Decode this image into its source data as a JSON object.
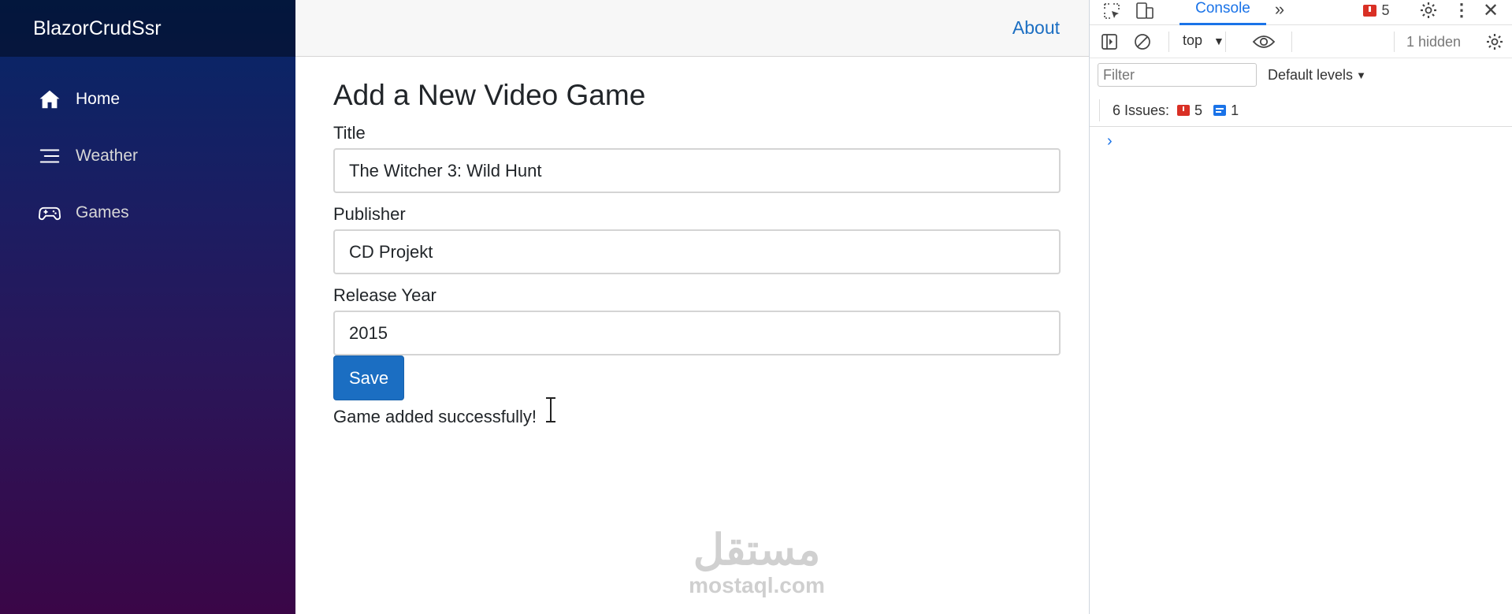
{
  "app": {
    "brand": "BlazorCrudSsr"
  },
  "sidebar": {
    "items": [
      {
        "label": "Home",
        "icon": "home-icon"
      },
      {
        "label": "Weather",
        "icon": "list-icon"
      },
      {
        "label": "Games",
        "icon": "gamepad-icon"
      }
    ]
  },
  "topbar": {
    "about_link": "About"
  },
  "form": {
    "heading": "Add a New Video Game",
    "title_label": "Title",
    "title_value": "The Witcher 3: Wild Hunt",
    "publisher_label": "Publisher",
    "publisher_value": "CD Projekt",
    "year_label": "Release Year",
    "year_value": "2015",
    "save_label": "Save",
    "status_message": "Game added successfully!"
  },
  "watermark": {
    "arabic": "مستقل",
    "latin": "mostaql.com"
  },
  "devtools": {
    "console_tab": "Console",
    "error_count": "5",
    "context_select": "top",
    "hidden_count": "1 hidden",
    "filter_placeholder": "Filter",
    "levels_select": "Default levels",
    "issues_label": "6 Issues:",
    "issues_errors": "5",
    "issues_info": "1",
    "accent": "#1a73e8",
    "error_color": "#d93025"
  },
  "colors": {
    "primary": "#1b6ec2",
    "sidebar_top": "#052767",
    "sidebar_bottom": "#3a0647"
  }
}
